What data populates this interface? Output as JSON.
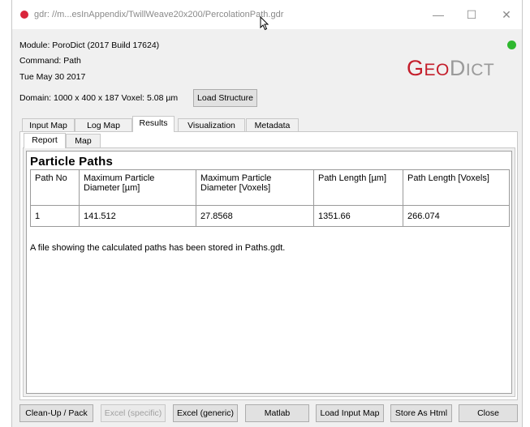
{
  "window": {
    "title": "gdr: //m...esInAppendix/TwillWeave20x200/PercolationPath.gdr",
    "controls": {
      "minimize": "—",
      "maximize": "☐",
      "close": "✕"
    }
  },
  "info": {
    "module": "Module:  PoroDict   (2017 Build 17624)",
    "command": "Command:  Path",
    "date": "Tue May 30 2017",
    "domain": "Domain: 1000 x 400 x 187   Voxel: 5.08 µm",
    "load_structure": "Load Structure"
  },
  "logo": {
    "g": "G",
    "eo": "EO",
    "d": "D",
    "ict": "ICT"
  },
  "status": {
    "color": "#2fb82f"
  },
  "tabs": [
    "Input Map",
    "Log Map",
    "Results",
    "Visualization",
    "Metadata"
  ],
  "active_tab": "Results",
  "subtabs": [
    "Report",
    "Map"
  ],
  "report": {
    "title": "Particle Paths",
    "columns": [
      "Path No",
      "Maximum Particle Diameter [µm]",
      "Maximum Particle Diameter [Voxels]",
      "Path Length [µm]",
      "Path Length [Voxels]"
    ],
    "rows": [
      [
        "1",
        "141.512",
        "27.8568",
        "1351.66",
        "266.074"
      ]
    ],
    "note": "A file showing the calculated paths has been stored in Paths.gdt."
  },
  "buttons": {
    "cleanup": "Clean-Up / Pack",
    "excel_specific": "Excel (specific)",
    "excel_generic": "Excel (generic)",
    "matlab": "Matlab",
    "load_input_map": "Load Input Map",
    "store_html": "Store As Html",
    "close": "Close"
  },
  "colors": {
    "brand_red": "#c41e2b",
    "app_icon": "#d9253b"
  }
}
